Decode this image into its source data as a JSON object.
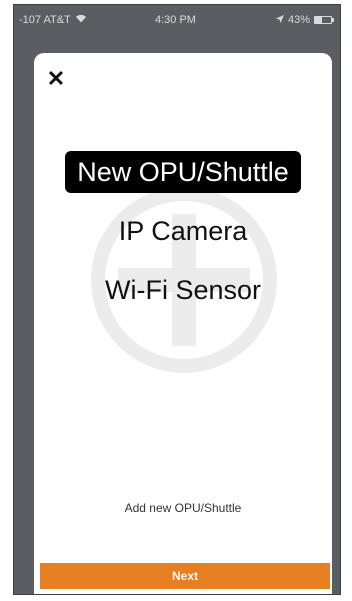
{
  "status_bar": {
    "carrier": "-107 AT&T",
    "time": "4:30 PM",
    "battery": "43%",
    "battery_level": 0.43
  },
  "dialog": {
    "close_icon": "close-icon",
    "options": [
      {
        "label": "New OPU/Shuttle",
        "selected": true
      },
      {
        "label": "IP Camera",
        "selected": false
      },
      {
        "label": "Wi-Fi Sensor",
        "selected": false
      }
    ],
    "description": "Add new OPU/Shuttle",
    "next_label": "Next"
  },
  "colors": {
    "accent": "#e67e22",
    "selected_bg": "#000000",
    "plus_watermark": "#ececec"
  }
}
